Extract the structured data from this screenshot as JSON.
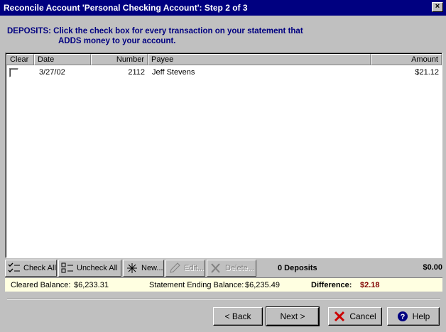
{
  "window": {
    "title": "Reconcile Account 'Personal Checking Account': Step 2 of 3",
    "close": "×"
  },
  "instruction": {
    "line1": "DEPOSITS: Click the check box for every transaction on your statement that",
    "line2": "ADDS money to your account."
  },
  "columns": [
    "Clear",
    "Date",
    "Number",
    "Payee",
    "Amount"
  ],
  "rows": [
    {
      "clear": false,
      "date": "3/27/02",
      "number": "2112",
      "payee": "Jeff Stevens",
      "amount": "$21.12"
    }
  ],
  "toolbar": {
    "check_all": "Check All",
    "uncheck_all": "Uncheck All",
    "new": "New...",
    "edit": "Edit...",
    "delete": "Delete...",
    "count": "0 Deposits",
    "total": "$0.00"
  },
  "balance": {
    "cleared_label": "Cleared Balance:",
    "cleared_value": "$6,233.31",
    "statement_label": "Statement Ending Balance:",
    "statement_value": "$6,235.49",
    "difference_label": "Difference:",
    "difference_value": "$2.18"
  },
  "buttons": {
    "back": "< Back",
    "next": "Next >",
    "cancel": "Cancel",
    "help": "Help"
  },
  "colors": {
    "title_bar": "#000080",
    "instruction": "#000080",
    "balance_bg": "#ffffe1",
    "difference": "#800000"
  }
}
